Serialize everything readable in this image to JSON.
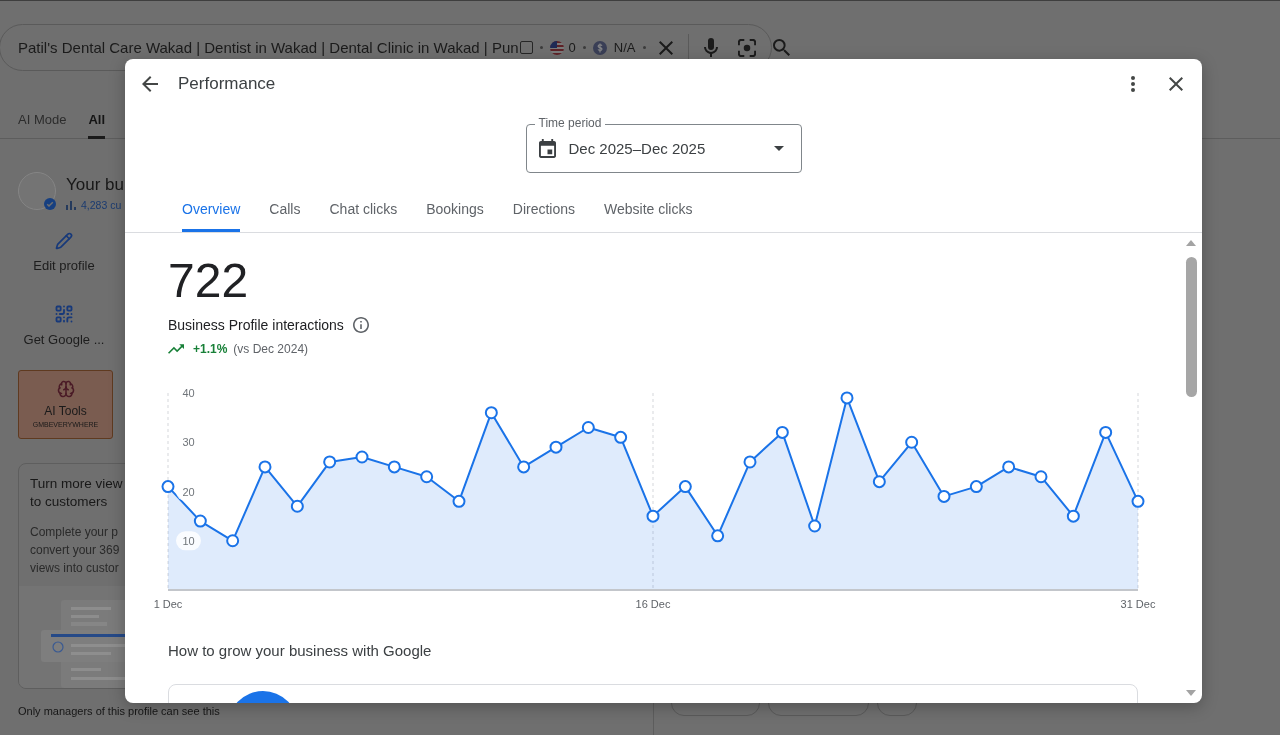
{
  "search_bar": {
    "query": "Patil's Dental Care Wakad | Dentist in Wakad | Dental Clinic in Wakad | Pun",
    "checkbox": {
      "checked": false
    },
    "flag_count": "0",
    "price": "N/A"
  },
  "search_tabs": [
    {
      "label": "AI Mode",
      "selected": false
    },
    {
      "label": "All",
      "selected": true
    }
  ],
  "business_panel": {
    "title": "Your bu",
    "views": "4,283 cu",
    "actions": [
      {
        "kind": "edit",
        "label": "Edit profile"
      },
      {
        "kind": "qr",
        "label": "Get Google ..."
      }
    ],
    "ai_tools": {
      "title": "AI Tools",
      "subtitle": "GMBEVERYWHERE"
    },
    "promo": {
      "title_lines": [
        "Turn more view",
        "to customers"
      ],
      "body_lines": [
        "Complete your p",
        "convert your 369",
        "views into custor"
      ]
    },
    "footnote": "Only managers of this profile can see this"
  },
  "chips": [
    {
      "kind": "website"
    },
    {
      "kind": "directions"
    },
    {
      "kind": "more"
    }
  ],
  "dialog": {
    "title": "Performance",
    "time_period": {
      "label": "Time period",
      "value": "Dec 2025–Dec 2025"
    },
    "tabs": [
      {
        "label": "Overview",
        "selected": true
      },
      {
        "label": "Calls",
        "selected": false
      },
      {
        "label": "Chat clicks",
        "selected": false
      },
      {
        "label": "Bookings",
        "selected": false
      },
      {
        "label": "Directions",
        "selected": false
      },
      {
        "label": "Website clicks",
        "selected": false
      }
    ],
    "total": "722",
    "metric_label": "Business Profile interactions",
    "change": {
      "value": "+1.1%",
      "comparison": "(vs Dec 2024)"
    },
    "chart_data": {
      "type": "area",
      "categories": [
        "1 Dec",
        null,
        null,
        null,
        null,
        null,
        null,
        null,
        null,
        null,
        null,
        null,
        null,
        null,
        null,
        "16 Dec",
        null,
        null,
        null,
        null,
        null,
        null,
        null,
        null,
        null,
        null,
        null,
        null,
        null,
        null,
        "31 Dec"
      ],
      "ylim": [
        0,
        40
      ],
      "yticks": [
        10,
        20,
        30,
        40
      ],
      "series": [
        {
          "color": "#1a73e8",
          "values": [
            21,
            14,
            10,
            25,
            17,
            26,
            27,
            25,
            23,
            18,
            36,
            25,
            29,
            33,
            31,
            15,
            21,
            11,
            26,
            32,
            13,
            39,
            22,
            30,
            19,
            21,
            25,
            23,
            15,
            32,
            18
          ]
        }
      ]
    },
    "section_title": "How to grow your business with Google"
  }
}
